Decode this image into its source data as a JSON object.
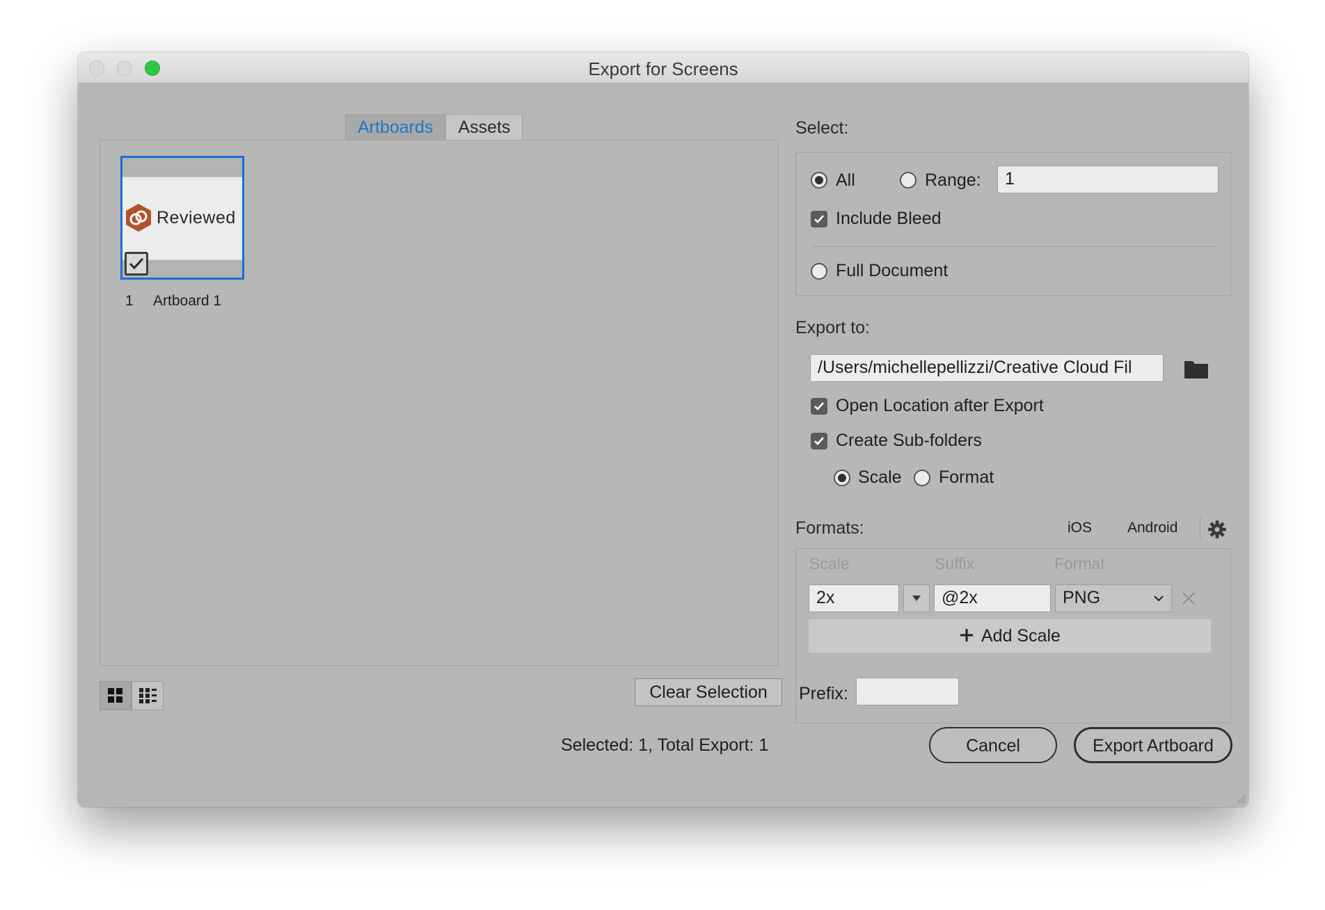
{
  "window": {
    "title": "Export for Screens"
  },
  "tabs": [
    {
      "label": "Artboards",
      "active": true
    },
    {
      "label": "Assets",
      "active": false
    }
  ],
  "artboards": [
    {
      "number": "1",
      "name": "Artboard 1",
      "thumbnail_text": "Reviewed",
      "checked": true
    }
  ],
  "left_footer": {
    "clear_selection_label": "Clear Selection"
  },
  "select": {
    "heading": "Select:",
    "all_label": "All",
    "range_label": "Range:",
    "range_value": "1",
    "include_bleed_label": "Include Bleed",
    "full_document_label": "Full Document"
  },
  "export_to": {
    "heading": "Export to:",
    "path_value": "/Users/michellepellizzi/Creative Cloud Fil",
    "open_location_label": "Open Location after Export",
    "create_subfolders_label": "Create Sub-folders",
    "scale_label": "Scale",
    "format_label": "Format"
  },
  "formats": {
    "heading": "Formats:",
    "ios_label": "iOS",
    "android_label": "Android",
    "columns": {
      "scale": "Scale",
      "suffix": "Suffix",
      "format": "Format"
    },
    "rows": [
      {
        "scale": "2x",
        "suffix": "@2x",
        "format": "PNG"
      }
    ],
    "add_scale_label": "Add Scale"
  },
  "prefix": {
    "label": "Prefix:",
    "value": ""
  },
  "status": {
    "text": "Selected: 1, Total Export: 1"
  },
  "actions": {
    "cancel_label": "Cancel",
    "export_label": "Export Artboard"
  },
  "colors": {
    "accent": "#1c6fd1",
    "tab_active_text": "#1f78c8",
    "dialog_bg": "#b7b7b7",
    "logo": "#b0532b"
  }
}
